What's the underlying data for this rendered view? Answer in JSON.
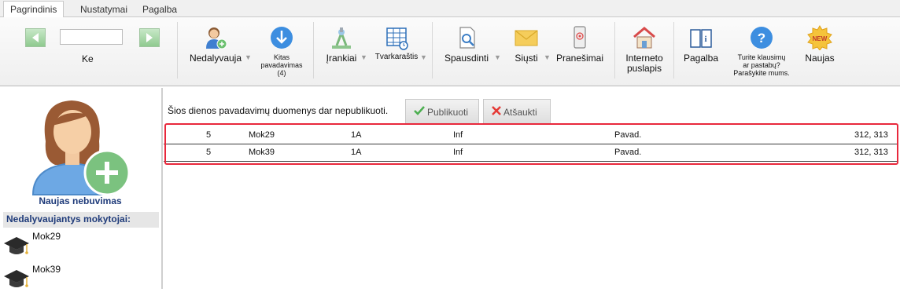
{
  "tabs": [
    {
      "label": "Pagrindinis",
      "active": true
    },
    {
      "label": "Nustatymai",
      "active": false
    },
    {
      "label": "Pagalba",
      "active": false
    }
  ],
  "ribbon": {
    "nav_label": "Ke",
    "nav_input_value": "",
    "absent": "Nedalyvauja",
    "other_sub_line1": "Kitas",
    "other_sub_line2": "pavadavimas",
    "other_sub_line3": "(4)",
    "tools": "Įrankiai",
    "timetable": "Tvarkaraštis",
    "print": "Spausdinti",
    "send": "Siųsti",
    "messages": "Pranešimai",
    "website_line1": "Interneto",
    "website_line2": "puslapis",
    "help": "Pagalba",
    "questions_line1": "Turite klausimų",
    "questions_line2": "ar pastabų?",
    "questions_line3": "Parašykite mums.",
    "new": "Naujas",
    "new_badge": "NEW"
  },
  "left": {
    "new_absence": "Naujas nebuvimas",
    "absent_header": "Nedalyvaujantys mokytojai:",
    "teachers": [
      "Mok29",
      "Mok39"
    ]
  },
  "main": {
    "status": "Šios dienos pavadavimų duomenys dar nepublikuoti.",
    "publish": "Publikuoti",
    "cancel": "Atšaukti",
    "rows": [
      {
        "period": "5",
        "teacher": "Mok29",
        "class": "1A",
        "subject": "Inf",
        "type": "Pavad.",
        "rooms": "312, 313"
      },
      {
        "period": "5",
        "teacher": "Mok39",
        "class": "1A",
        "subject": "Inf",
        "type": "Pavad.",
        "rooms": "312, 313"
      }
    ]
  },
  "colors": {
    "accent": "#1f3b7a",
    "highlight": "#e8283c",
    "nav_green": "#8fca8f"
  }
}
